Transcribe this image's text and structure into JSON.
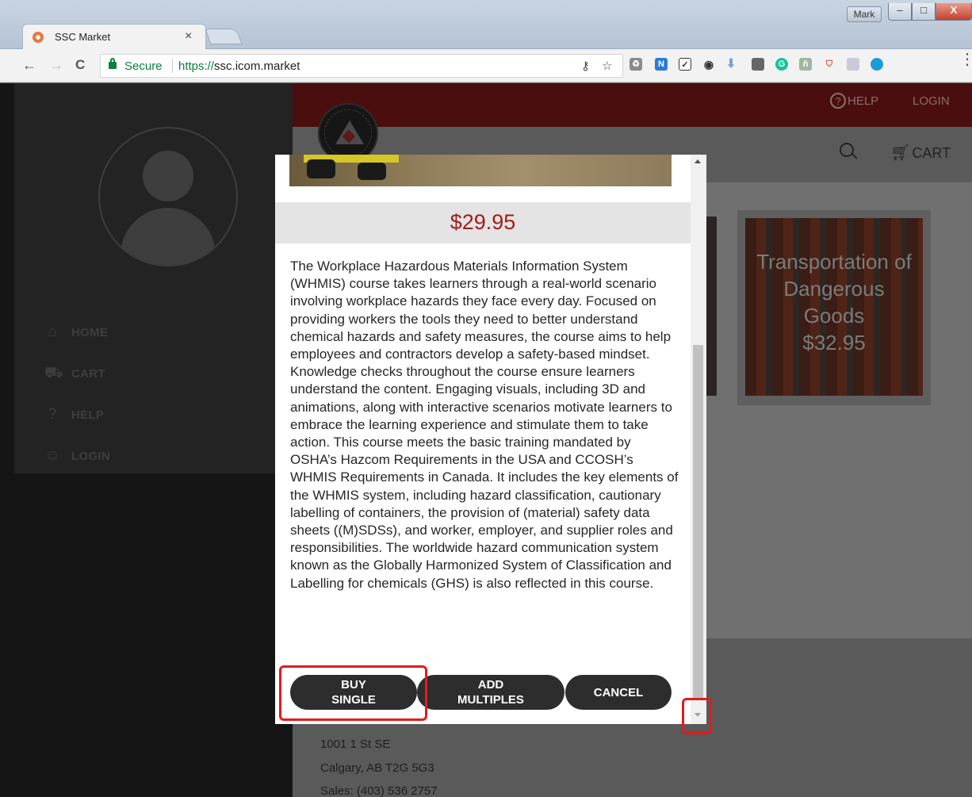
{
  "window": {
    "user_label": "Mark",
    "minimize": "–",
    "maximize": "□",
    "close": "X"
  },
  "tab": {
    "title": "SSC Market",
    "close": "×"
  },
  "toolbar": {
    "back": "←",
    "forward": "→",
    "reload": "C",
    "secure_label": "Secure",
    "url_scheme": "https://",
    "url_host": "ssc.icom.market",
    "menu": "⋮"
  },
  "header": {
    "help_label": "HELP",
    "login_label": "LOGIN",
    "cart_label": "CART"
  },
  "sidebar": {
    "items": [
      {
        "label": "HOME",
        "icon": "home-icon"
      },
      {
        "label": "CART",
        "icon": "cart-icon"
      },
      {
        "label": "HELP",
        "icon": "help-icon"
      },
      {
        "label": "LOGIN",
        "icon": "account-icon"
      }
    ]
  },
  "background_card": {
    "title_line1": "Transportation of",
    "title_line2": "Dangerous",
    "title_line3": "Goods",
    "price": "$32.95"
  },
  "footer": {
    "address1": "1001 1 St SE",
    "address2": "Calgary, AB T2G 5G3",
    "sales": "Sales: (403) 536 2757"
  },
  "modal": {
    "price": "$29.95",
    "description": "The Workplace Hazardous Materials Information System (WHMIS) course takes learners through a real-world scenario involving workplace hazards they face every day. Focused on providing workers the tools they need to better understand chemical hazards and safety measures, the course aims to help employees and contractors develop a safety-based mindset. Knowledge checks throughout the course ensure learners understand the content. Engaging visuals, including 3D and animations, along with interactive scenarios motivate learners to embrace the learning experience and stimulate them to take action. This course meets the basic training mandated by OSHA’s Hazcom Requirements in the USA and CCOSH’s WHMIS Requirements in Canada. It includes the key elements of the WHMIS system, including hazard classification, cautionary labelling of containers, the provision of (material) safety data sheets ((M)SDSs), and worker, employer, and supplier roles and responsibilities. The worldwide hazard communication system known as the Globally Harmonized System of Classification and Labelling for chemicals (GHS) is also reflected in this course.",
    "buy_line1": "BUY",
    "buy_line2": "SINGLE",
    "add_line1": "ADD",
    "add_line2": "MULTIPLES",
    "cancel": "CANCEL"
  },
  "colors": {
    "price_red": "#a11d1d",
    "highlight_red": "#e31b1b",
    "secure_green": "#0b8043",
    "button_dark": "#2d2d2d"
  }
}
